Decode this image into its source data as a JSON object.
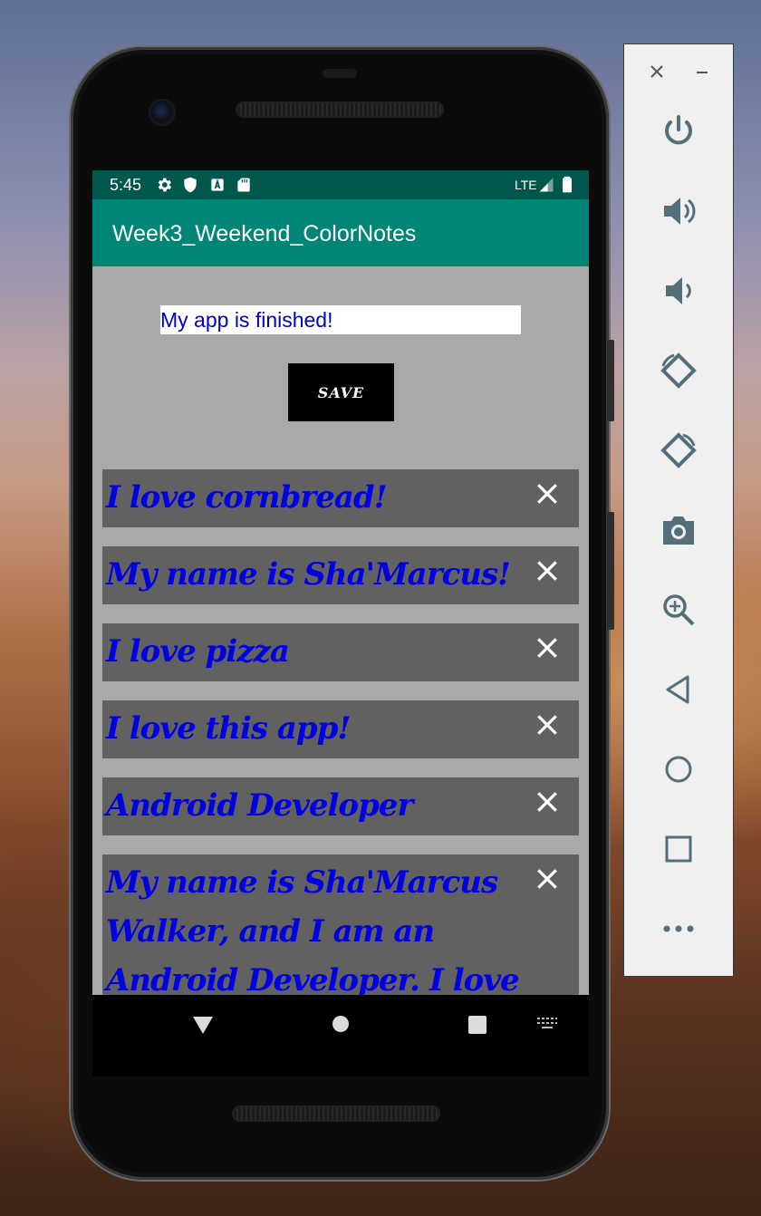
{
  "status_bar": {
    "time": "5:45",
    "network": "LTE",
    "icons": [
      "gear-icon",
      "shield-icon",
      "a-box-icon",
      "sd-card-icon",
      "signal-icon",
      "battery-icon"
    ]
  },
  "app_bar": {
    "title": "Week3_Weekend_ColorNotes"
  },
  "editor": {
    "input_value": "My app is finished!",
    "save_label": "SAVE"
  },
  "notes": [
    {
      "text": "I love cornbread!"
    },
    {
      "text": "My name is Sha'Marcus!"
    },
    {
      "text": "I love pizza"
    },
    {
      "text": "I love this app!"
    },
    {
      "text": "Android Developer"
    },
    {
      "text": "My name is Sha'Marcus Walker, and I am an Android Developer. I love my new job!"
    }
  ],
  "nav_bar": {
    "icons": [
      "back-icon",
      "home-icon",
      "recents-icon",
      "keyboard-icon"
    ]
  },
  "emulator_panel": {
    "icons": [
      "close-icon",
      "minimize-icon",
      "power-icon",
      "volume-up-icon",
      "volume-down-icon",
      "rotate-left-icon",
      "rotate-right-icon",
      "camera-icon",
      "zoom-icon",
      "back-icon",
      "home-icon",
      "overview-icon",
      "more-icon"
    ]
  },
  "colors": {
    "app_bar": "#008577",
    "status_bar": "#00574b",
    "content_bg": "#a9a9a9",
    "note_bg": "#616161",
    "note_text": "#0000e0",
    "panel_icon": "#546e7a"
  }
}
